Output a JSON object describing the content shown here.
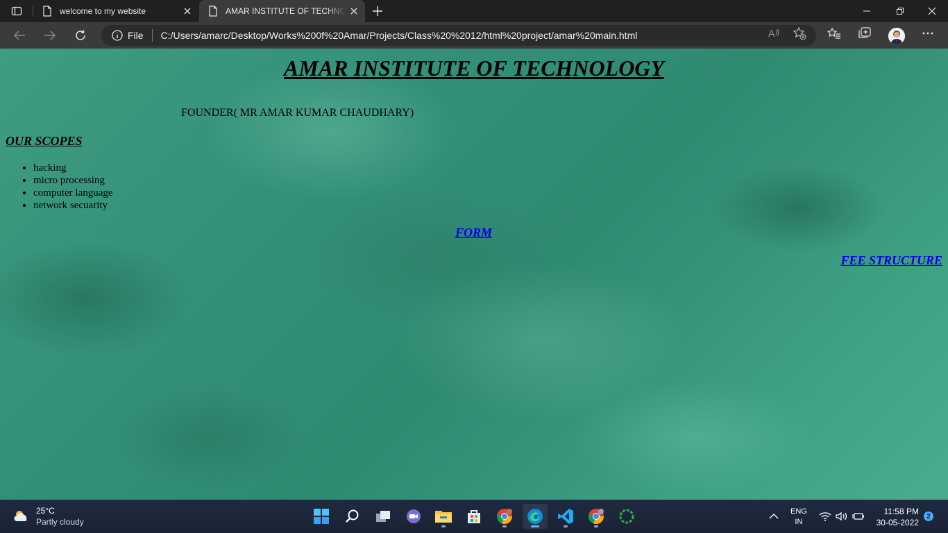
{
  "browser": {
    "tabs": [
      {
        "title": "welcome to my website",
        "active": false
      },
      {
        "title": "AMAR INSTITUTE OF TECHNOLOGY",
        "active": true
      }
    ],
    "address": {
      "scheme_label": "File",
      "url": "C:/Users/amarc/Desktop/Works%200f%20Amar/Projects/Class%20%2012/html%20project/amar%20main.html"
    }
  },
  "page": {
    "title": "AMAR INSTITUTE OF TECHNOLOGY",
    "founder": "FOUNDER( MR AMAR KUMAR CHAUDHARY)",
    "scopes_heading": "OUR SCOPES",
    "scopes": [
      "hacking",
      "micro processing",
      "computer language",
      "network secuarity"
    ],
    "links": {
      "form": "FORM",
      "fee_structure": "FEE STRUCTURE"
    },
    "colors": {
      "link": "#0000ee",
      "text": "#000000",
      "background": "#3a9a7f"
    }
  },
  "taskbar": {
    "weather": {
      "temp": "25°C",
      "condition": "Partly cloudy"
    },
    "apps": [
      "start-icon",
      "search-icon",
      "task-view-icon",
      "chat-icon",
      "file-explorer-icon",
      "store-icon",
      "chrome-icon",
      "edge-icon",
      "vscode-icon",
      "chrome-profile-icon",
      "loader-app-icon"
    ],
    "language": {
      "line1": "ENG",
      "line2": "IN"
    },
    "time": "11:58 PM",
    "date": "30-05-2022",
    "notifications": "2"
  }
}
